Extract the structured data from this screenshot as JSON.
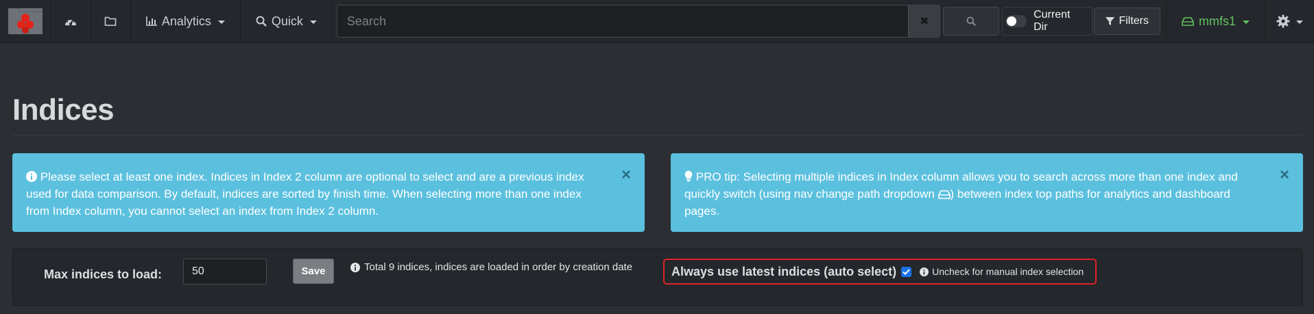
{
  "nav": {
    "analytics_label": "Analytics",
    "quick_label": "Quick",
    "search_placeholder": "Search",
    "clear_symbol": "✖",
    "current_dir_label": "Current Dir",
    "filters_label": "Filters",
    "index_label": "mmfs1",
    "accent_color": "#62c462"
  },
  "page": {
    "title": "Indices"
  },
  "alerts": {
    "info_text": "Please select at least one index. Indices in Index 2 column are optional to select and are a previous index used for data comparison. By default, indices are sorted by finish time. When selecting more than one index from Index column, you cannot select an index from Index 2 column.",
    "tip_text_before": "PRO tip: Selecting multiple indices in Index column allows you to search across more than one index and quickly switch (using nav change path dropdown",
    "tip_text_after": ") between index top paths for analytics and dashboard pages.",
    "close_symbol": "×",
    "background_color": "#5bc0de"
  },
  "settings": {
    "max_indices_label": "Max indices to load:",
    "max_indices_value": "50",
    "save_label": "Save",
    "total_info": "Total 9 indices, indices are loaded in order by creation date",
    "auto_select_label": "Always use latest indices (auto select)",
    "auto_select_checked": true,
    "auto_select_hint": "Uncheck for manual index selection",
    "highlight_color": "#e0232b"
  }
}
